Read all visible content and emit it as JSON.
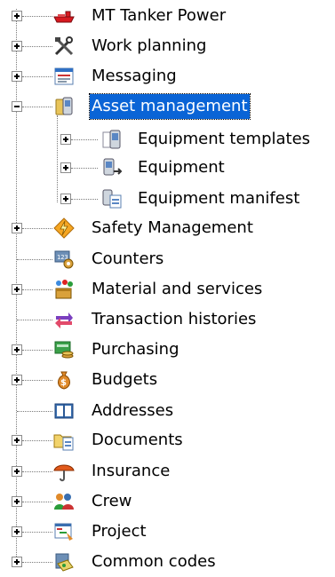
{
  "tree": {
    "items": [
      {
        "label": "MT Tanker Power",
        "icon": "tanker-ship-icon",
        "expander": "plus",
        "level": 0
      },
      {
        "label": "Work planning",
        "icon": "tools-icon",
        "expander": "plus",
        "level": 0
      },
      {
        "label": "Messaging",
        "icon": "message-form-icon",
        "expander": "plus",
        "level": 0
      },
      {
        "label": "Asset management",
        "icon": "asset-device-icon",
        "expander": "minus",
        "level": 0,
        "selected": true
      },
      {
        "label": "Equipment templates",
        "icon": "equipment-template-icon",
        "expander": "plus",
        "level": 1
      },
      {
        "label": "Equipment",
        "icon": "equipment-icon",
        "expander": "plus",
        "level": 1
      },
      {
        "label": "Equipment manifest",
        "icon": "equipment-manifest-icon",
        "expander": "plus",
        "level": 1
      },
      {
        "label": "Safety Management",
        "icon": "lightning-safety-icon",
        "expander": "plus",
        "level": 0
      },
      {
        "label": "Counters",
        "icon": "counter-gear-icon",
        "expander": "none",
        "level": 0
      },
      {
        "label": "Material and services",
        "icon": "materials-icon",
        "expander": "plus",
        "level": 0
      },
      {
        "label": "Transaction histories",
        "icon": "transaction-arrows-icon",
        "expander": "none",
        "level": 0
      },
      {
        "label": "Purchasing",
        "icon": "purchasing-icon",
        "expander": "plus",
        "level": 0
      },
      {
        "label": "Budgets",
        "icon": "money-bag-icon",
        "expander": "plus",
        "level": 0
      },
      {
        "label": "Addresses",
        "icon": "address-book-icon",
        "expander": "none",
        "level": 0
      },
      {
        "label": "Documents",
        "icon": "document-folder-icon",
        "expander": "plus",
        "level": 0
      },
      {
        "label": "Insurance",
        "icon": "umbrella-icon",
        "expander": "plus",
        "level": 0
      },
      {
        "label": "Crew",
        "icon": "crew-people-icon",
        "expander": "plus",
        "level": 0
      },
      {
        "label": "Project",
        "icon": "project-icon",
        "expander": "plus",
        "level": 0
      },
      {
        "label": "Common codes",
        "icon": "common-codes-icon",
        "expander": "plus",
        "level": 0
      }
    ]
  }
}
